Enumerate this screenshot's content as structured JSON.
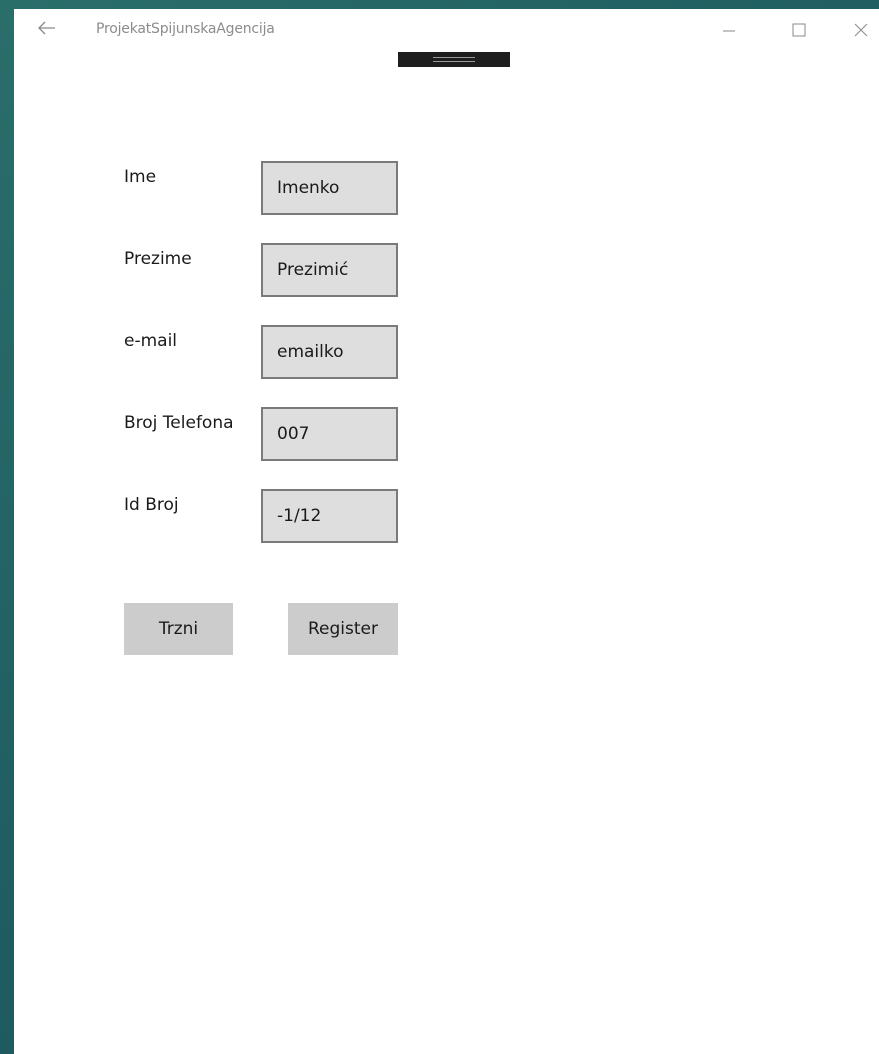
{
  "window": {
    "title": "ProjekatSpijunskaAgencija",
    "back_icon": "back-arrow-icon",
    "minimize_icon": "minimize-icon",
    "maximize_icon": "maximize-icon",
    "close_icon": "close-icon"
  },
  "form": {
    "fields": [
      {
        "label": "Ime",
        "value": "Imenko"
      },
      {
        "label": "Prezime",
        "value": "Prezimić"
      },
      {
        "label": "e-mail",
        "value": "emailko"
      },
      {
        "label": "Broj Telefona",
        "value": "007"
      },
      {
        "label": "Id Broj",
        "value": "-1/12"
      }
    ]
  },
  "buttons": {
    "trzni": "Trzni",
    "register": "Register"
  }
}
